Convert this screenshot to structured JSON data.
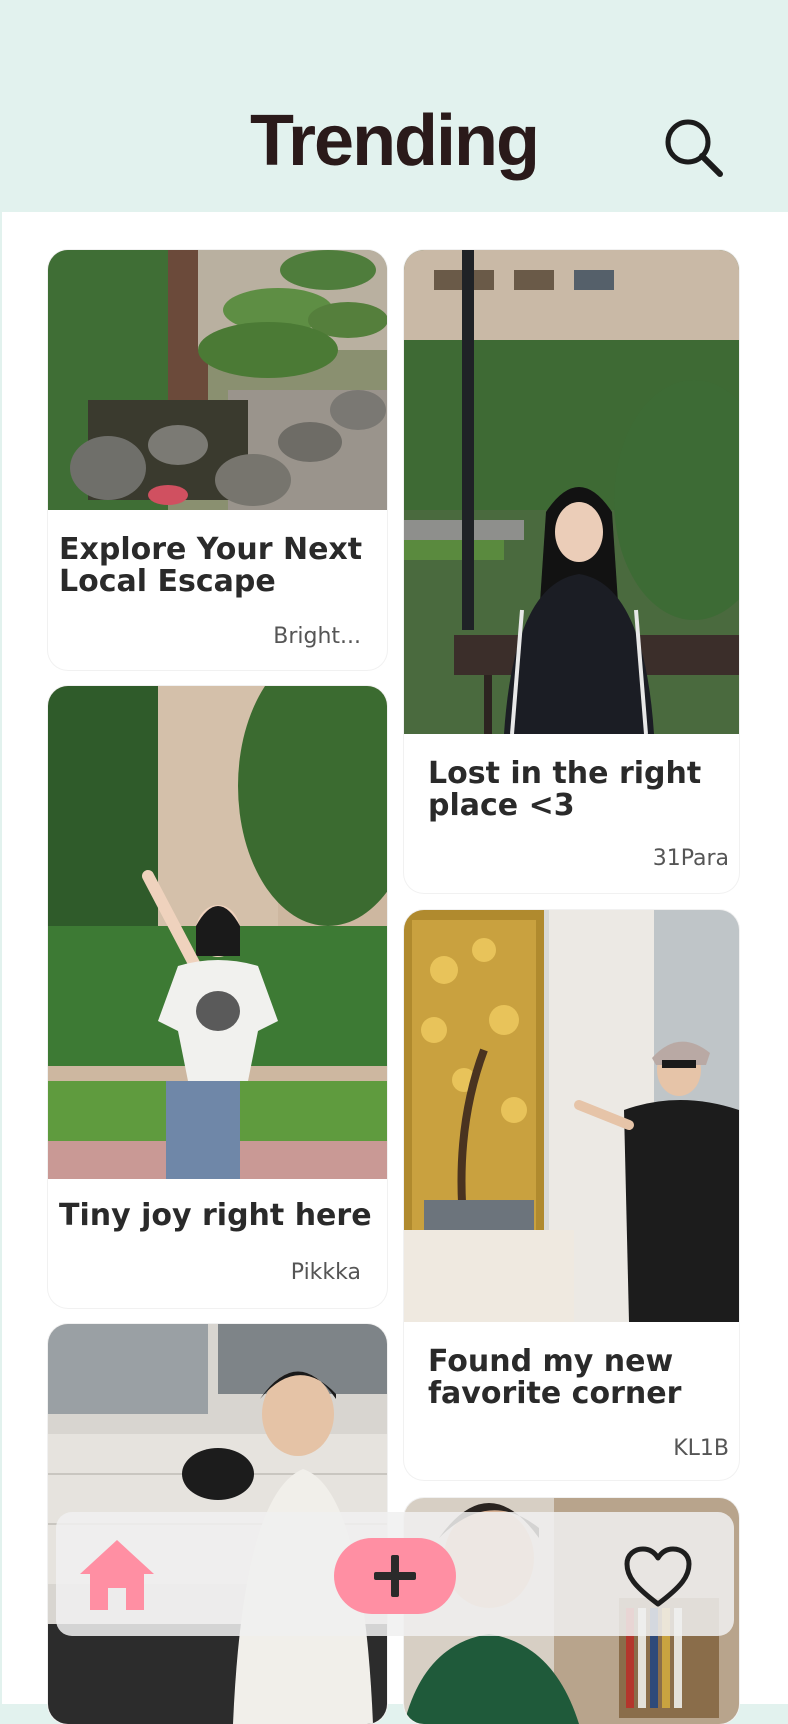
{
  "header": {
    "title": "Trending"
  },
  "icons": {
    "search": "search-icon",
    "home": "home-icon",
    "add": "plus-icon",
    "favorites": "heart-icon"
  },
  "colors": {
    "background": "#e2f2ee",
    "accent": "#ff8fa3",
    "title_text": "#2a1a1a"
  },
  "cards": [
    {
      "title": "Explore Your Next Local Escape",
      "author": "Bright...",
      "photo": "garden with bonsai trees and pond stones"
    },
    {
      "title": "Lost in the right place <3",
      "author": "31Para",
      "photo": "girl in black tracksuit sitting on park bench"
    },
    {
      "title": "Tiny joy right here",
      "author": "Pikkka",
      "photo": "girl in white t-shirt raising arm in courtyard"
    },
    {
      "title": "Found my new favorite corner",
      "author": "KL1B",
      "photo": "person in cap beside golden tree wall art"
    },
    {
      "title": "",
      "author": "",
      "photo": "girl holding pot lid in kitchen"
    },
    {
      "title": "",
      "author": "",
      "photo": "girl in green jersey by bookshelf"
    }
  ]
}
